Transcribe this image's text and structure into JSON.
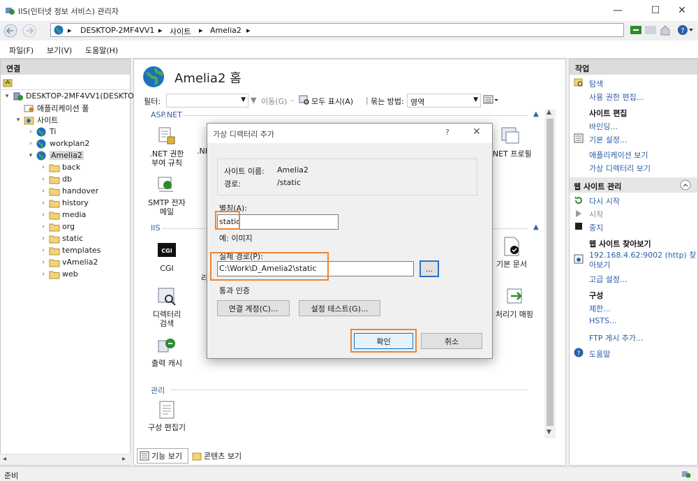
{
  "window": {
    "title": "IIS(인터넷 정보 서비스) 관리자"
  },
  "address": {
    "crumbs": [
      "DESKTOP-2MF4VV1",
      "사이트",
      "Amelia2"
    ]
  },
  "menu": {
    "file": "파일(F)",
    "view": "보기(V)",
    "help": "도움말(H)"
  },
  "left": {
    "header": "연결",
    "server": "DESKTOP-2MF4VV1(DESKTO",
    "app_pools": "애플리케이션 풀",
    "sites": "사이트",
    "site_items": [
      "Ti",
      "workplan2",
      "Amelia2"
    ],
    "folders": [
      "back",
      "db",
      "handover",
      "history",
      "media",
      "org",
      "static",
      "templates",
      "vAmelia2",
      "web"
    ]
  },
  "center": {
    "title": "Amelia2 홈",
    "filter": {
      "label": "필터:",
      "go": "이동(G)",
      "show_all": "모두 표시(A)",
      "group_by_label": "묶는 방법:",
      "group_by_value": "영역"
    },
    "sections": {
      "aspnet": "ASP.NET",
      "iis": "IIS",
      "management": "관리"
    },
    "features": {
      "net_auth": ".NET 권한\n부여 규칙",
      "net_partial": ".NE",
      "net_profile": ".NET 프로필",
      "smtp": "SMTP 전자\n메일",
      "cgi": "CGI",
      "default_doc": "기본 문서",
      "dir_browse": "디렉터리\n검색",
      "handler_map": "처리기 매핑",
      "output_cache": "출력 캐시",
      "config_editor": "구성 편집기",
      "partial_r": "리"
    },
    "tabs": {
      "features": "기능 보기",
      "content": "콘텐츠 보기"
    }
  },
  "right": {
    "header": "작업",
    "explore": "탐색",
    "edit_perms": "사용 권한 편집...",
    "edit_site": "사이트 편집",
    "bindings": "바인딩...",
    "basic_settings": "기본 설정...",
    "view_apps": "애플리케이션 보기",
    "view_vdirs": "가상 디렉터리 보기",
    "manage_site": "웹 사이트 관리",
    "restart": "다시 시작",
    "start": "시작",
    "stop": "중지",
    "browse_site": "웹 사이트 찾아보기",
    "browse_url_1": "192.168.4.62:9002 (http) 찾",
    "browse_url_2": "아보기",
    "advanced": "고급 설정...",
    "config": "구성",
    "limits": "제한...",
    "hsts": "HSTS...",
    "ftp": "FTP 게시 추가...",
    "help": "도움말"
  },
  "dialog": {
    "title": "가상 디렉터리 추가",
    "help": "?",
    "site_name_label": "사이트 이름:",
    "site_name_value": "Amelia2",
    "path_label": "경로:",
    "path_value": "/static",
    "alias_label": "별칭(A):",
    "alias_value": "static",
    "example": "예: 이미지",
    "physical_label": "실제 경로(P):",
    "physical_value": "C:\\Work\\D_Amelia2\\static",
    "browse_btn": "...",
    "auth_label": "통과 인증",
    "connect_as": "연결 계정(C)...",
    "test_settings": "설정 테스트(G)...",
    "ok": "확인",
    "cancel": "취소"
  },
  "status": {
    "text": "준비"
  },
  "colors": {
    "accent": "#2b5ea8",
    "highlight": "#f0822e",
    "section": "#3a5d9c"
  }
}
